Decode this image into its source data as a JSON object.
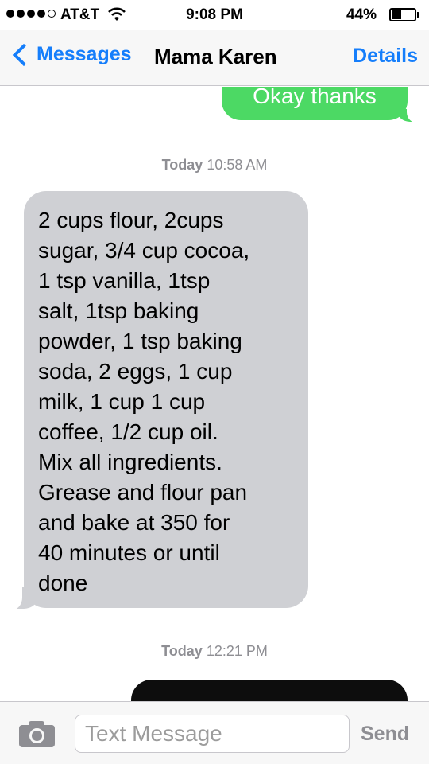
{
  "status_bar": {
    "carrier": "AT&T",
    "time": "9:08 PM",
    "battery_percent": "44%",
    "battery_level": 0.44,
    "signal_bars": 4,
    "signal_total": 5,
    "wifi_icon": "wifi-icon"
  },
  "nav": {
    "back_label": "Messages",
    "title": "Mama Karen",
    "details_label": "Details",
    "accent_color": "#157efb"
  },
  "messages": [
    {
      "direction": "outgoing",
      "text": "Okay thanks",
      "color": "#4cd964"
    },
    {
      "type": "timestamp",
      "day": "Today",
      "time": "10:58 AM"
    },
    {
      "direction": "incoming",
      "text": "2 cups flour, 2cups\nsugar, 3/4 cup cocoa,\n1 tsp vanilla, 1tsp\nsalt, 1tsp baking\npowder, 1 tsp baking\nsoda, 2 eggs, 1 cup\nmilk, 1 cup 1 cup\ncoffee, 1/2 cup oil.\nMix all ingredients.\nGrease and flour pan\nand bake at 350 for\n40 minutes or until\ndone",
      "color": "#cfd0d4"
    },
    {
      "type": "timestamp",
      "day": "Today",
      "time": "12:21 PM"
    },
    {
      "direction": "outgoing",
      "type": "image"
    }
  ],
  "toolbar": {
    "camera_icon": "camera-icon",
    "input_placeholder": "Text Message",
    "send_label": "Send"
  }
}
